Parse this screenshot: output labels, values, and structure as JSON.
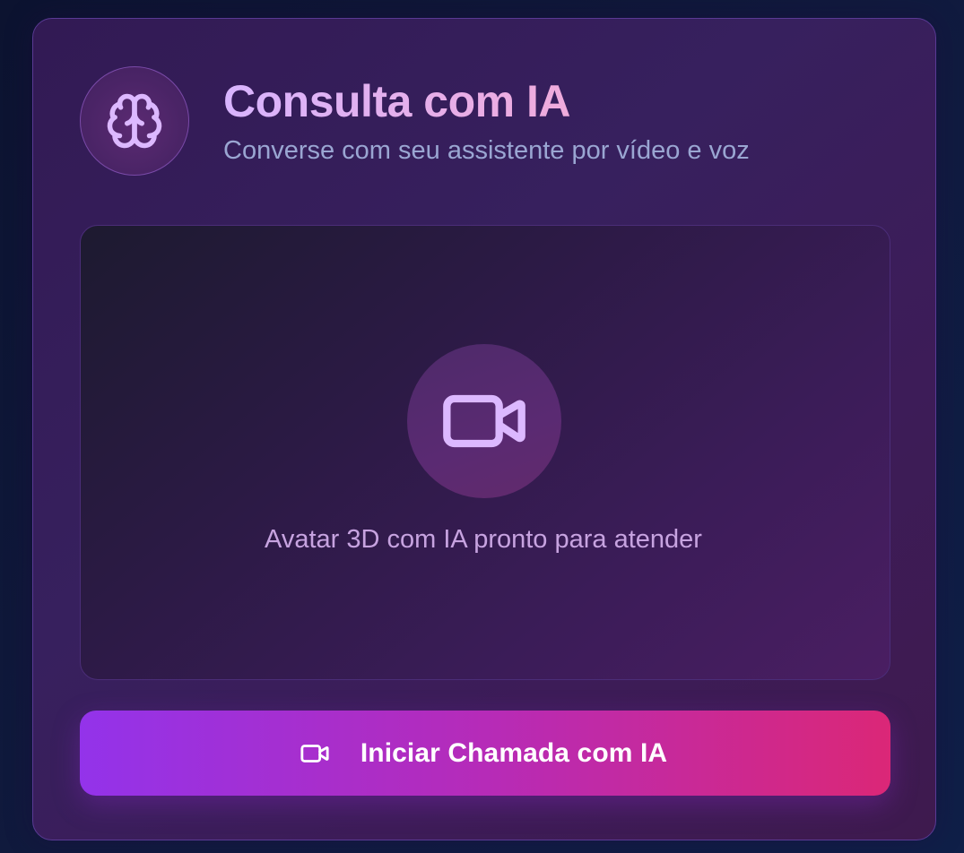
{
  "header": {
    "title": "Consulta com IA",
    "subtitle": "Converse com seu assistente por vídeo e voz",
    "icon": "brain-icon"
  },
  "video_panel": {
    "icon": "video-camera-icon",
    "status_text": "Avatar 3D com IA pronto para atender"
  },
  "call_button": {
    "label": "Iniciar Chamada com IA",
    "icon": "video-camera-icon"
  },
  "colors": {
    "accent_light": "#d8b4fe",
    "button_start": "#9333ea",
    "button_end": "#db2777",
    "subtitle": "#9aa6d2",
    "panel_text": "#c7a3e0"
  }
}
